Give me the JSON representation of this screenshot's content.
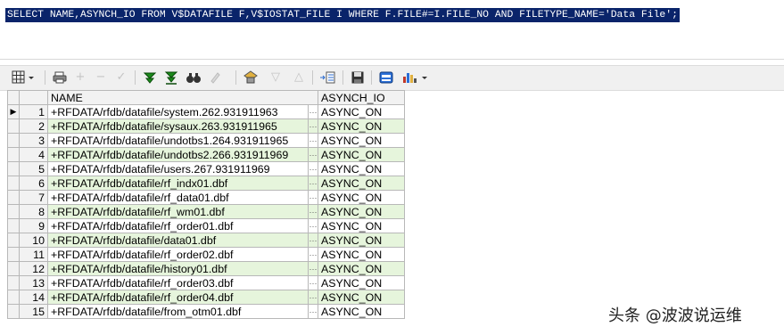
{
  "sql": "SELECT NAME,ASYNCH_IO FROM V$DATAFILE F,V$IOSTAT_FILE I WHERE F.FILE#=I.FILE_NO AND FILETYPE_NAME='Data File';",
  "toolbar": {
    "icons": [
      "grid-options-icon",
      "print-icon",
      "add-record-icon",
      "delete-record-icon",
      "post-edit-icon",
      "filter-icon",
      "clear-filter-icon",
      "find-icon",
      "clear-icon",
      "query-icon",
      "sort-asc-icon",
      "sort-desc-icon",
      "record-view-icon",
      "save-icon",
      "export-icon",
      "chart-icon"
    ]
  },
  "grid": {
    "columns": [
      "NAME",
      "ASYNCH_IO"
    ],
    "rows": [
      {
        "n": "1",
        "name": "+RFDATA/rfdb/datafile/system.262.931911963",
        "aio": "ASYNC_ON"
      },
      {
        "n": "2",
        "name": "+RFDATA/rfdb/datafile/sysaux.263.931911965",
        "aio": "ASYNC_ON"
      },
      {
        "n": "3",
        "name": "+RFDATA/rfdb/datafile/undotbs1.264.931911965",
        "aio": "ASYNC_ON"
      },
      {
        "n": "4",
        "name": "+RFDATA/rfdb/datafile/undotbs2.266.931911969",
        "aio": "ASYNC_ON"
      },
      {
        "n": "5",
        "name": "+RFDATA/rfdb/datafile/users.267.931911969",
        "aio": "ASYNC_ON"
      },
      {
        "n": "6",
        "name": "+RFDATA/rfdb/datafile/rf_indx01.dbf",
        "aio": "ASYNC_ON"
      },
      {
        "n": "7",
        "name": "+RFDATA/rfdb/datafile/rf_data01.dbf",
        "aio": "ASYNC_ON"
      },
      {
        "n": "8",
        "name": "+RFDATA/rfdb/datafile/rf_wm01.dbf",
        "aio": "ASYNC_ON"
      },
      {
        "n": "9",
        "name": "+RFDATA/rfdb/datafile/rf_order01.dbf",
        "aio": "ASYNC_ON"
      },
      {
        "n": "10",
        "name": "+RFDATA/rfdb/datafile/data01.dbf",
        "aio": "ASYNC_ON"
      },
      {
        "n": "11",
        "name": "+RFDATA/rfdb/datafile/rf_order02.dbf",
        "aio": "ASYNC_ON"
      },
      {
        "n": "12",
        "name": "+RFDATA/rfdb/datafile/history01.dbf",
        "aio": "ASYNC_ON"
      },
      {
        "n": "13",
        "name": "+RFDATA/rfdb/datafile/rf_order03.dbf",
        "aio": "ASYNC_ON"
      },
      {
        "n": "14",
        "name": "+RFDATA/rfdb/datafile/rf_order04.dbf",
        "aio": "ASYNC_ON"
      },
      {
        "n": "15",
        "name": "+RFDATA/rfdb/datafile/from_otm01.dbf",
        "aio": "ASYNC_ON"
      }
    ],
    "ellipsis": "···",
    "current_row_marker": "▶"
  },
  "watermark": "头条 @波波说运维",
  "colors": {
    "selection": "#0a246a",
    "alt_row": "#e6f5dc"
  }
}
